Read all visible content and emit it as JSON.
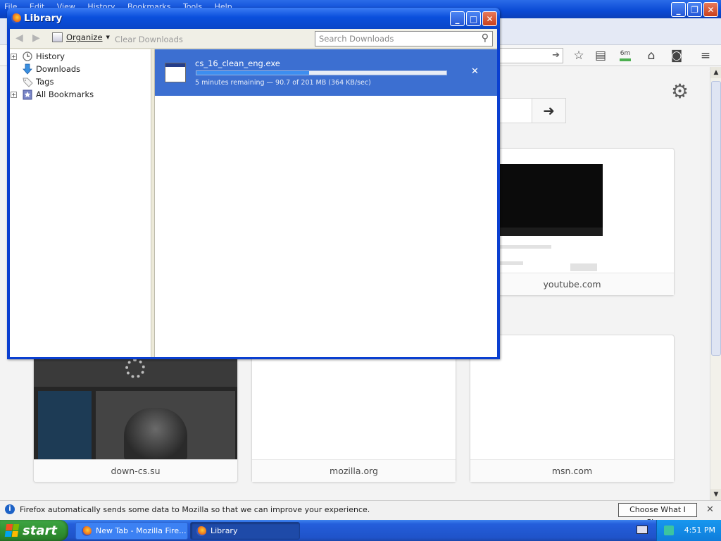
{
  "firefox": {
    "menu": [
      "File",
      "Edit",
      "View",
      "History",
      "Bookmarks",
      "Tools",
      "Help"
    ],
    "download_timer": "6m",
    "tiles": [
      {
        "caption": "youtube.com"
      },
      {
        "caption": "down-cs.su"
      },
      {
        "caption": "mozilla.org"
      },
      {
        "caption": "msn.com"
      }
    ],
    "notification": {
      "text": "Firefox automatically sends some data to Mozilla so that we can improve your experience.",
      "button": "Choose What I Share"
    }
  },
  "library": {
    "title": "Library",
    "toolbar": {
      "organize": "Organize",
      "clear_downloads": "Clear Downloads",
      "search_placeholder": "Search Downloads"
    },
    "sidebar": [
      {
        "label": "History",
        "expandable": true,
        "icon": "clock-icon"
      },
      {
        "label": "Downloads",
        "expandable": false,
        "icon": "download-arrow-icon"
      },
      {
        "label": "Tags",
        "expandable": false,
        "icon": "tag-icon"
      },
      {
        "label": "All Bookmarks",
        "expandable": true,
        "icon": "star-bookmarks-icon"
      }
    ],
    "download": {
      "filename": "cs_16_clean_eng.exe",
      "status": "5 minutes remaining — 90.7 of 201 MB (364 KB/sec)",
      "progress": 0.45
    }
  },
  "taskbar": {
    "start": "start",
    "buttons": [
      {
        "label": "New Tab - Mozilla Fire..."
      },
      {
        "label": "Library"
      }
    ],
    "clock": "4:51 PM"
  }
}
